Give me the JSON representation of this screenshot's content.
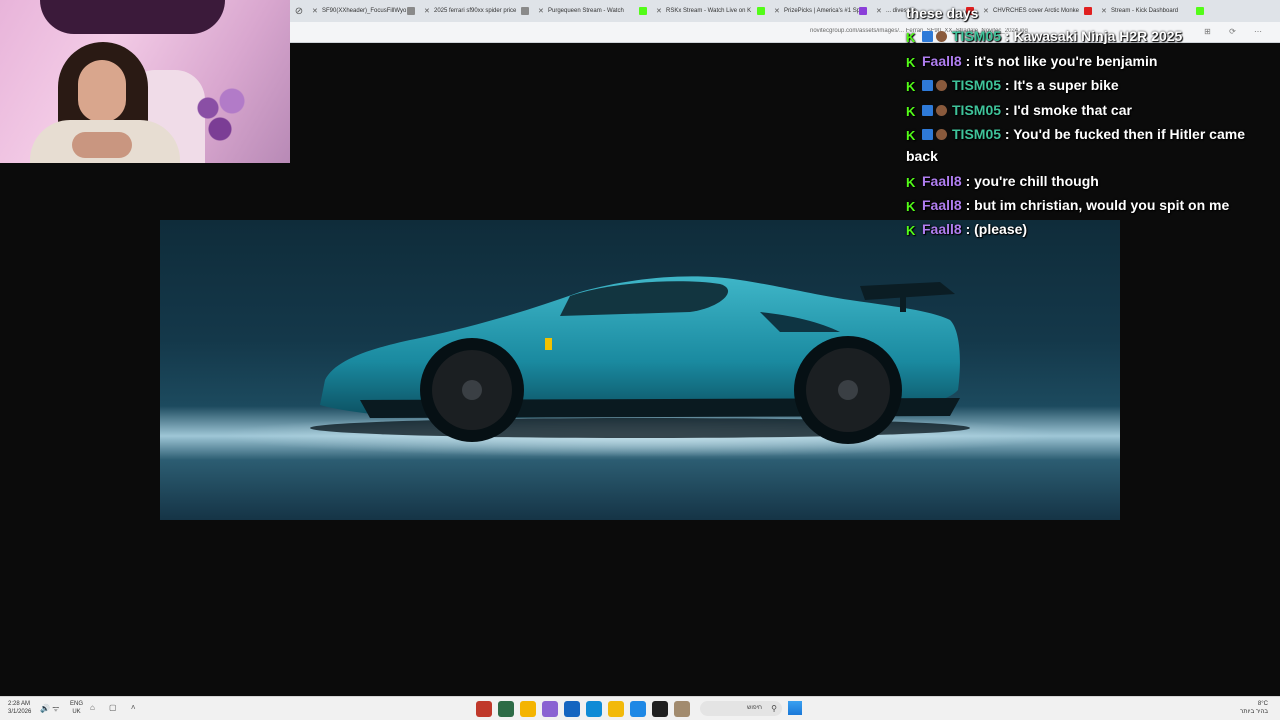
{
  "browser": {
    "tabs": [
      {
        "label": "SF90(XXheader)_FocusFillWyo",
        "fav_color": "#8a8a8a"
      },
      {
        "label": "2025 ferrari sf90xx spider price",
        "fav_color": "#8a8a8a"
      },
      {
        "label": "Purgequeen Stream - Watch",
        "fav_color": "#53fc18"
      },
      {
        "label": "RSKx Stream - Watch Live on K",
        "fav_color": "#53fc18"
      },
      {
        "label": "PrizePicks | America's #1 Sport",
        "fav_color": "#8b3fd9"
      },
      {
        "label": "... dives the",
        "fav_color": "#e02020"
      },
      {
        "label": "CHVRCHES cover Arctic Monke",
        "fav_color": "#e02020"
      },
      {
        "label": "Stream - Kick Dashboard",
        "fav_color": "#53fc18"
      }
    ],
    "address": "novitecgroup.com/assets/images/...  Ferrari_SF90_XX_Stradale_Novitec_2024.jpg"
  },
  "chat": {
    "messages": [
      {
        "badges": [],
        "user": "",
        "text": "these days",
        "user_class": ""
      },
      {
        "badges": [
          "k",
          "v",
          "c"
        ],
        "user": "TISM05",
        "text": ": Kawasaki Ninja H2R 2025",
        "user_class": "user-green"
      },
      {
        "badges": [
          "k"
        ],
        "user": "Faall8",
        "text": ": it's not like you're benjamin",
        "user_class": "user-purple"
      },
      {
        "badges": [
          "k",
          "v",
          "c"
        ],
        "user": "TISM05",
        "text": ": It's a super bike",
        "user_class": "user-green"
      },
      {
        "badges": [
          "k",
          "v",
          "c"
        ],
        "user": "TISM05",
        "text": ": I'd smoke that car",
        "user_class": "user-green"
      },
      {
        "badges": [
          "k",
          "v",
          "c"
        ],
        "user": "TISM05",
        "text": ": You'd be fucked then if Hitler came back",
        "user_class": "user-green"
      },
      {
        "badges": [
          "k"
        ],
        "user": "Faall8",
        "text": ": you're chill though",
        "user_class": "user-purple"
      },
      {
        "badges": [
          "k"
        ],
        "user": "Faall8",
        "text": ": but im christian, would you spit on me",
        "user_class": "user-purple"
      },
      {
        "badges": [
          "k"
        ],
        "user": "Faall8",
        "text": ": (please)",
        "user_class": "user-purple"
      }
    ]
  },
  "taskbar": {
    "time": "2:28 AM",
    "date": "3/1/2026",
    "lang_top": "ENG",
    "lang_bottom": "UK",
    "search_text": "חיפוש",
    "weather_top": "8°C",
    "weather_bottom": "בהיר ביותר",
    "app_colors": [
      "#c0392b",
      "#2d6b46",
      "#f4b400",
      "#8a63d2",
      "#1565c0",
      "#0f8bd6",
      "#f2b90a",
      "#1e88e5",
      "#202020",
      "#a28b6e"
    ]
  }
}
